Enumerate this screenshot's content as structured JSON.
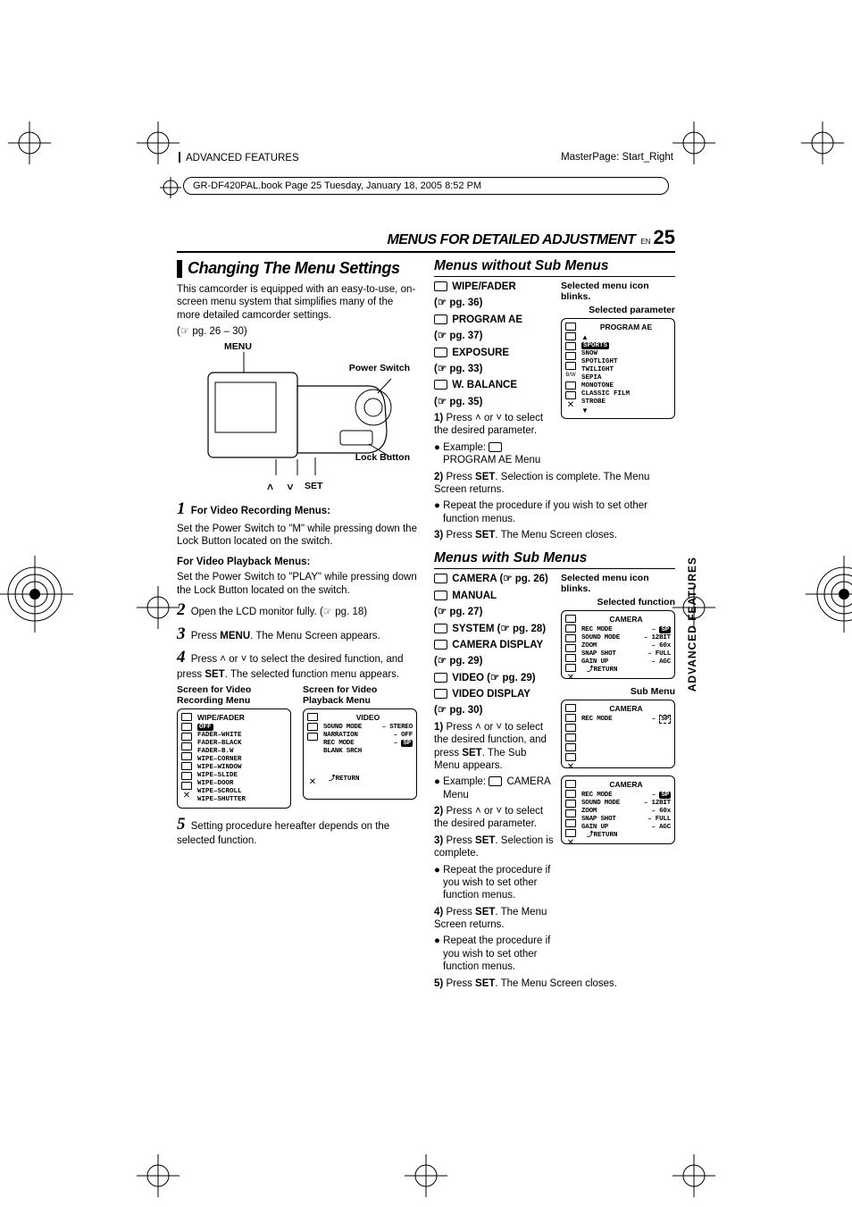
{
  "header": {
    "left": "ADVANCED FEATURES",
    "right": "MasterPage: Start_Right",
    "fileline": "GR-DF420PAL.book  Page 25  Tuesday, January 18, 2005  8:52 PM"
  },
  "section_head": {
    "title": "MENUS FOR DETAILED ADJUSTMENT",
    "en": "EN",
    "page": "25"
  },
  "left_col": {
    "h2": "Changing The Menu Settings",
    "intro1": "This camcorder is equipped with an easy-to-use, on-screen menu system that simplifies many of the more detailed camcorder settings.",
    "intro2": "(☞ pg. 26 – 30)",
    "cam_labels": {
      "menu": "MENU",
      "power": "Power Switch",
      "lock": "Lock Button",
      "set": "SET",
      "arrows": "˄   ˅"
    },
    "step1_hdr": "For Video Recording Menus:",
    "step1_body": "Set the Power Switch to \"M\" while pressing down the Lock Button located on the switch.",
    "pb_hdr": "For Video Playback Menus:",
    "pb_body": "Set the Power Switch to \"PLAY\" while pressing down the Lock Button located on the switch.",
    "step2": "Open the LCD monitor fully. (☞ pg. 18)",
    "step3a": "Press ",
    "step3b": "MENU",
    "step3c": ". The Menu Screen appears.",
    "step4a": "Press ˄ or ˅ to select the desired function, and press ",
    "step4b": "SET",
    "step4c": ". The selected function menu appears.",
    "sc_left_cap": "Screen for Video Recording Menu",
    "sc_right_cap": "Screen for Video Playback Menu",
    "menuA": {
      "title": "WIPE/FADER",
      "items": [
        "OFF",
        "FADER–WHITE",
        "FADER–BLACK",
        "FADER–B.W",
        "WIPE–CORNER",
        "WIPE–WINDOW",
        "WIPE–SLIDE",
        "WIPE–DOOR",
        "WIPE–SCROLL",
        "WIPE–SHUTTER"
      ]
    },
    "menuB": {
      "title": "VIDEO",
      "rows": [
        [
          "SOUND MODE",
          "– STEREO"
        ],
        [
          "NARRATION",
          "– OFF"
        ],
        [
          "REC MODE",
          "– SP"
        ],
        [
          "BLANK SRCH",
          ""
        ]
      ],
      "return": "RETURN"
    },
    "step5": "Setting procedure hereafter depends on the selected function."
  },
  "right_col": {
    "no_sub": {
      "h3": "Menus without Sub Menus",
      "items": [
        {
          "label": "WIPE/FADER",
          "pg": "(☞ pg. 36)"
        },
        {
          "label": "PROGRAM AE",
          "pg": "(☞ pg. 37)"
        },
        {
          "label": "EXPOSURE",
          "pg": "(☞ pg. 33)"
        },
        {
          "label": "W. BALANCE",
          "pg": "(☞ pg. 35)"
        }
      ],
      "step1": [
        "Press ˄ or ˅ to select the desired parameter."
      ],
      "ex_lbl": "Example:",
      "ex_val": "PROGRAM AE Menu",
      "step2": [
        "Press ",
        "SET",
        ". Selection is complete. The Menu Screen returns."
      ],
      "bullet1": "Repeat the procedure if you wish to set other function menus.",
      "step3": [
        "Press ",
        "SET",
        ". The Menu Screen closes."
      ],
      "fig_cap1": "Selected menu icon blinks.",
      "fig_cap2": "Selected parameter",
      "menuC": {
        "title": "PROGRAM  AE",
        "items": [
          "SPORTS",
          "SNOW",
          "SPOTLIGHT",
          "TWILIGHT",
          "SEPIA",
          "MONOTONE",
          "CLASSIC FILM",
          "STROBE"
        ],
        "side": [
          "",
          "",
          "",
          "",
          "",
          "B/W",
          "",
          ""
        ]
      }
    },
    "sub": {
      "h3": "Menus with Sub Menus",
      "items": [
        {
          "label": "CAMERA",
          "pg": "(☞ pg. 26)"
        },
        {
          "label": "MANUAL",
          "pg": "(☞ pg. 27)"
        },
        {
          "label": "SYSTEM",
          "pg": "(☞ pg. 28)"
        },
        {
          "label": "CAMERA DISPLAY",
          "pg": "(☞ pg. 29)"
        },
        {
          "label": "VIDEO",
          "pg": "(☞ pg. 29)"
        },
        {
          "label": "VIDEO DISPLAY",
          "pg": "(☞ pg. 30)"
        }
      ],
      "step1": [
        "Press ˄ or ˅ to select the desired function, and press ",
        "SET",
        ". The Sub Menu appears."
      ],
      "ex_lbl": "Example:",
      "ex_val": "CAMERA Menu",
      "step2": "Press ˄ or ˅ to select the desired parameter.",
      "step3": [
        "Press ",
        "SET",
        ". Selection is complete."
      ],
      "bullet1": "Repeat the procedure if you wish to set other function menus.",
      "step4": [
        "Press ",
        "SET",
        ". The Menu Screen returns."
      ],
      "bullet2": "Repeat the procedure if you wish to set other function menus.",
      "step5": [
        "Press ",
        "SET",
        ". The Menu Screen closes."
      ],
      "fig_cap1": "Selected menu icon blinks.",
      "fig_cap2": "Selected function",
      "fig_cap3": "Sub Menu",
      "menuD": {
        "title": "CAMERA",
        "rows": [
          [
            "REC MODE",
            "– SP"
          ],
          [
            "SOUND MODE",
            "– 12BIT"
          ],
          [
            "ZOOM",
            "– 60x"
          ],
          [
            "SNAP SHOT",
            "– FULL"
          ],
          [
            "GAIN UP",
            "– AGC"
          ]
        ],
        "return": "RETURN"
      },
      "menuE": {
        "title": "CAMERA",
        "rows": [
          [
            "REC MODE",
            "– SP"
          ]
        ]
      },
      "menuF": {
        "title": "CAMERA",
        "rows": [
          [
            "REC MODE",
            "– SP"
          ],
          [
            "SOUND MODE",
            "– 12BIT"
          ],
          [
            "ZOOM",
            "– 60x"
          ],
          [
            "SNAP SHOT",
            "– FULL"
          ],
          [
            "GAIN UP",
            "– AGC"
          ]
        ],
        "return": "RETURN"
      }
    }
  },
  "sidetab": "ADVANCED FEATURES"
}
